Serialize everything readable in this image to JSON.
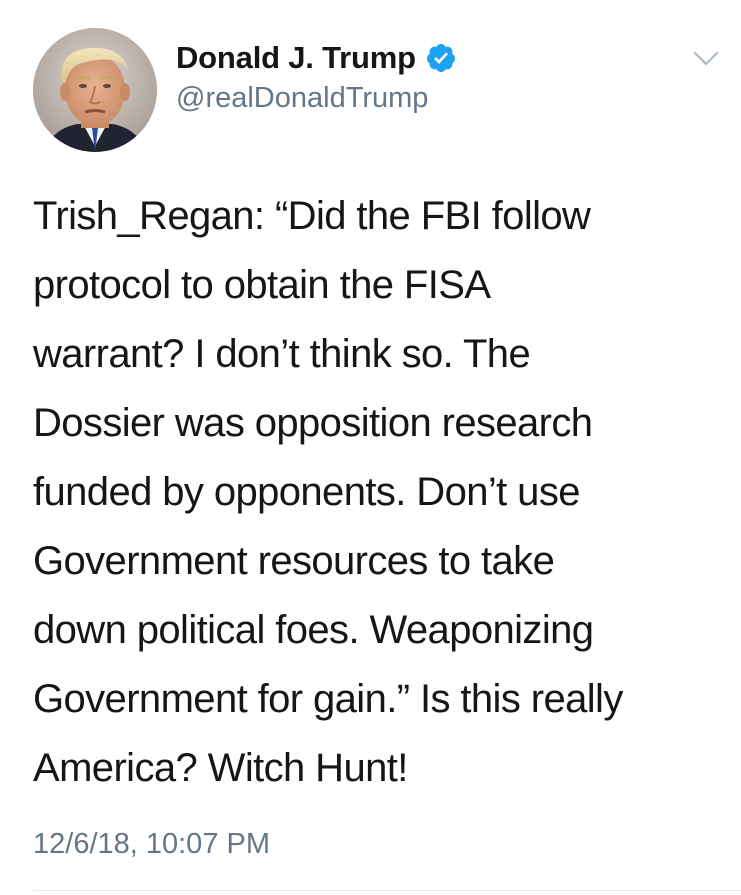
{
  "author": {
    "display_name": "Donald J. Trump",
    "handle": "@realDonaldTrump",
    "verified": true,
    "avatar_icon": "profile-photo"
  },
  "tweet": {
    "text": "Trish_Regan:  “Did the FBI follow\nprotocol to obtain the FISA\nwarrant? I don’t think so. The\nDossier was opposition research\nfunded by opponents. Don’t use\nGovernment resources to take\ndown political foes. Weaponizing\nGovernment for gain.” Is this really\nAmerica? Witch Hunt!",
    "timestamp": "12/6/18, 10:07 PM"
  },
  "icons": {
    "verified": "verified-badge-icon",
    "menu": "chevron-down-icon"
  },
  "colors": {
    "verified_blue": "#1da1f2",
    "secondary_text": "#657786",
    "primary_text": "#14171a",
    "divider": "#e1e8ed"
  }
}
